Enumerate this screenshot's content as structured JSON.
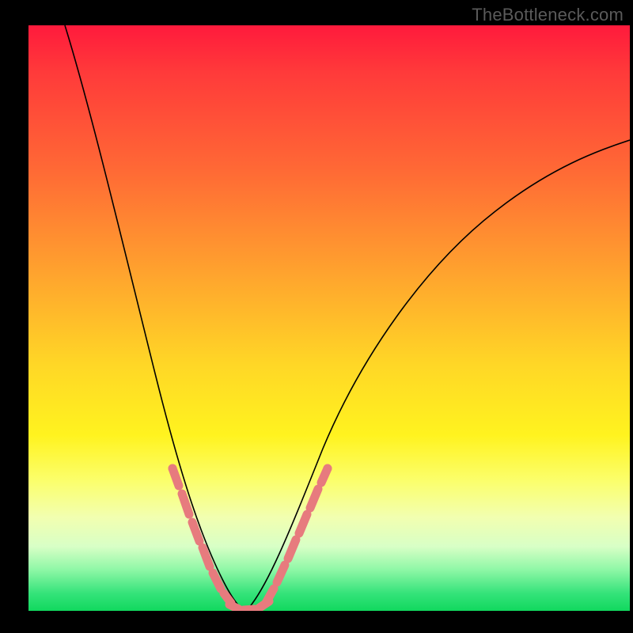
{
  "watermark_text": "TheBottleneck.com",
  "chart_data": {
    "type": "line",
    "title": "",
    "xlabel": "",
    "ylabel": "",
    "xlim": [
      0,
      100
    ],
    "ylim": [
      0,
      100
    ],
    "grid": false,
    "legend": false,
    "series": [
      {
        "name": "left-curve",
        "x": [
          6,
          8,
          10,
          12,
          14,
          16,
          18,
          20,
          22,
          24,
          26,
          28,
          31,
          33,
          35
        ],
        "y": [
          100,
          90,
          79,
          68,
          58,
          49,
          41,
          34,
          27,
          21,
          15,
          10,
          5,
          2,
          0
        ]
      },
      {
        "name": "right-curve",
        "x": [
          35,
          38,
          41,
          45,
          50,
          56,
          62,
          70,
          78,
          86,
          94,
          100
        ],
        "y": [
          0,
          4,
          11,
          22,
          34,
          45,
          54,
          62,
          68,
          73,
          77,
          80
        ]
      },
      {
        "name": "highlight-left-line",
        "x": [
          24,
          25.5,
          27,
          28.5,
          30,
          31.5,
          33,
          34
        ],
        "y": [
          22,
          18,
          14,
          11,
          8,
          5,
          3,
          1
        ]
      },
      {
        "name": "highlight-bottom-line",
        "x": [
          32.5,
          34,
          35.5,
          37,
          38.5,
          40
        ],
        "y": [
          1.2,
          0.4,
          0,
          0.5,
          1.8,
          3.5
        ]
      },
      {
        "name": "highlight-right-line",
        "x": [
          39,
          40.5,
          42,
          43.5,
          45,
          46.5,
          48
        ],
        "y": [
          4,
          7,
          11,
          15,
          19,
          23,
          27
        ]
      }
    ],
    "background_gradient": {
      "orientation": "vertical",
      "stops": [
        {
          "pos": 0.0,
          "color": "#ff1a3c"
        },
        {
          "pos": 0.42,
          "color": "#ffa22e"
        },
        {
          "pos": 0.7,
          "color": "#fff31f"
        },
        {
          "pos": 0.93,
          "color": "#8ef7a6"
        },
        {
          "pos": 1.0,
          "color": "#11d85e"
        }
      ]
    },
    "colors": {
      "curve": "#000000",
      "highlight": "#e77b7e",
      "frame": "#000000"
    }
  }
}
